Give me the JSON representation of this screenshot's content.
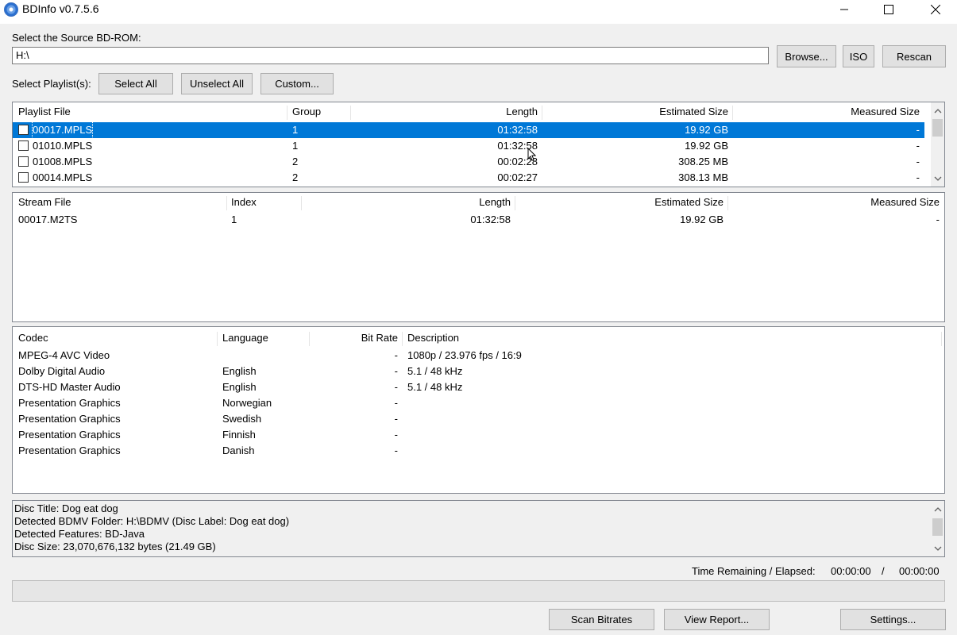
{
  "window": {
    "title": "BDInfo v0.7.5.6",
    "icon": "disc-icon"
  },
  "source": {
    "label": "Select the Source BD-ROM:",
    "value": "H:\\",
    "browse_label": "Browse...",
    "iso_label": "ISO",
    "rescan_label": "Rescan"
  },
  "playlists_bar": {
    "label": "Select Playlist(s):",
    "select_all": "Select All",
    "unselect_all": "Unselect All",
    "custom": "Custom..."
  },
  "playlist_table": {
    "headers": [
      "Playlist File",
      "Group",
      "Length",
      "Estimated Size",
      "Measured Size"
    ],
    "rows": [
      {
        "file": "00017.MPLS",
        "group": "1",
        "length": "01:32:58",
        "est": "19.92 GB",
        "measured": "-",
        "selected": true
      },
      {
        "file": "01010.MPLS",
        "group": "1",
        "length": "01:32:58",
        "est": "19.92 GB",
        "measured": "-",
        "selected": false
      },
      {
        "file": "01008.MPLS",
        "group": "2",
        "length": "00:02:28",
        "est": "308.25 MB",
        "measured": "-",
        "selected": false
      },
      {
        "file": "00014.MPLS",
        "group": "2",
        "length": "00:02:27",
        "est": "308.13 MB",
        "measured": "-",
        "selected": false
      }
    ]
  },
  "stream_table": {
    "headers": [
      "Stream File",
      "Index",
      "Length",
      "Estimated Size",
      "Measured Size"
    ],
    "rows": [
      {
        "file": "00017.M2TS",
        "index": "1",
        "length": "01:32:58",
        "est": "19.92 GB",
        "measured": "-"
      }
    ]
  },
  "codec_table": {
    "headers": [
      "Codec",
      "Language",
      "Bit Rate",
      "Description"
    ],
    "rows": [
      {
        "codec": "MPEG-4 AVC Video",
        "language": "",
        "bitrate": "-",
        "desc": "1080p / 23.976 fps / 16:9"
      },
      {
        "codec": "Dolby Digital Audio",
        "language": "English",
        "bitrate": "-",
        "desc": "5.1 / 48 kHz"
      },
      {
        "codec": "DTS-HD Master Audio",
        "language": "English",
        "bitrate": "-",
        "desc": "5.1 / 48 kHz"
      },
      {
        "codec": "Presentation Graphics",
        "language": "Norwegian",
        "bitrate": "-",
        "desc": ""
      },
      {
        "codec": "Presentation Graphics",
        "language": "Swedish",
        "bitrate": "-",
        "desc": ""
      },
      {
        "codec": "Presentation Graphics",
        "language": "Finnish",
        "bitrate": "-",
        "desc": ""
      },
      {
        "codec": "Presentation Graphics",
        "language": "Danish",
        "bitrate": "-",
        "desc": ""
      }
    ]
  },
  "disc_info": {
    "lines": [
      "Disc Title: Dog eat dog",
      "Detected BDMV Folder: H:\\BDMV (Disc Label: Dog eat dog)",
      "Detected Features: BD-Java",
      "Disc Size: 23,070,676,132 bytes (21.49 GB)"
    ]
  },
  "status": {
    "time_label": "Time Remaining / Elapsed:",
    "remaining": "00:00:00",
    "separator": "/",
    "elapsed": "00:00:00",
    "progress": 0
  },
  "bottom_buttons": {
    "scan": "Scan Bitrates",
    "report": "View Report...",
    "settings": "Settings..."
  },
  "colors": {
    "selection": "#0078d7",
    "window_bg": "#f0f0f0"
  }
}
